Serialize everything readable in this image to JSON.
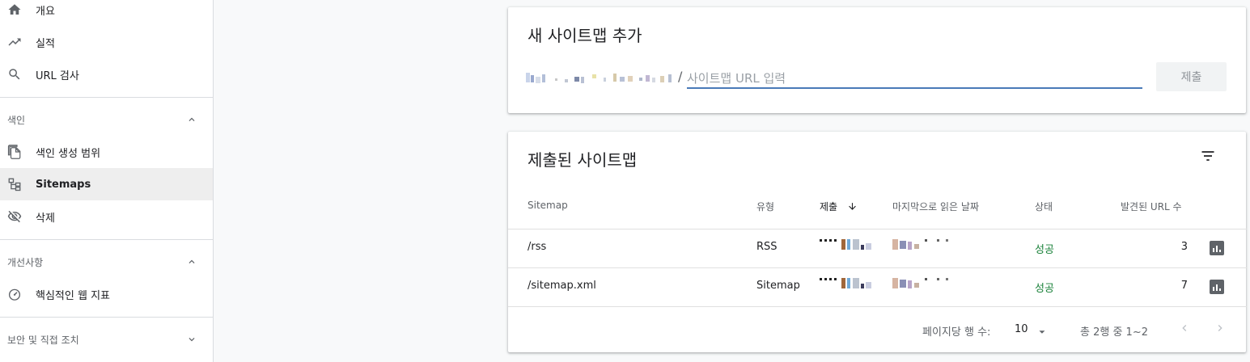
{
  "sidebar": {
    "items": [
      {
        "label": "개요",
        "icon": "home-icon"
      },
      {
        "label": "실적",
        "icon": "trending-up-icon"
      },
      {
        "label": "URL 검사",
        "icon": "search-icon"
      }
    ],
    "sections": [
      {
        "title": "색인",
        "expanded": true,
        "items": [
          {
            "label": "색인 생성 범위",
            "icon": "copy-pages-icon"
          },
          {
            "label": "Sitemaps",
            "icon": "sitemap-icon",
            "active": true
          },
          {
            "label": "삭제",
            "icon": "visibility-off-icon"
          }
        ]
      },
      {
        "title": "개선사항",
        "expanded": true,
        "items": [
          {
            "label": "핵심적인 웹 지표",
            "icon": "speedometer-icon"
          }
        ]
      },
      {
        "title": "보안 및 직접 조치",
        "expanded": false,
        "items": []
      }
    ]
  },
  "add_sitemap": {
    "title": "새 사이트맵 추가",
    "slash": "/",
    "input_value": "",
    "input_placeholder": "사이트맵 URL 입력",
    "submit_label": "제출"
  },
  "submitted": {
    "title": "제출된 사이트맵",
    "columns": [
      "Sitemap",
      "유형",
      "제출",
      "마지막으로 읽은 날짜",
      "상태",
      "발견된 URL 수"
    ],
    "sorted_column": "제출",
    "rows": [
      {
        "sitemap": "/rss",
        "type": "RSS",
        "status": "성공",
        "urls": "3"
      },
      {
        "sitemap": "/sitemap.xml",
        "type": "Sitemap",
        "status": "성공",
        "urls": "7"
      }
    ],
    "footer": {
      "rows_per_page_label": "페이지당 행 수:",
      "rows_per_page_value": "10",
      "range_text": "총 2행 중 1~2"
    }
  },
  "colors": {
    "accent": "#4a7ab8",
    "success": "#188038",
    "active_bg": "#eeeeee"
  }
}
